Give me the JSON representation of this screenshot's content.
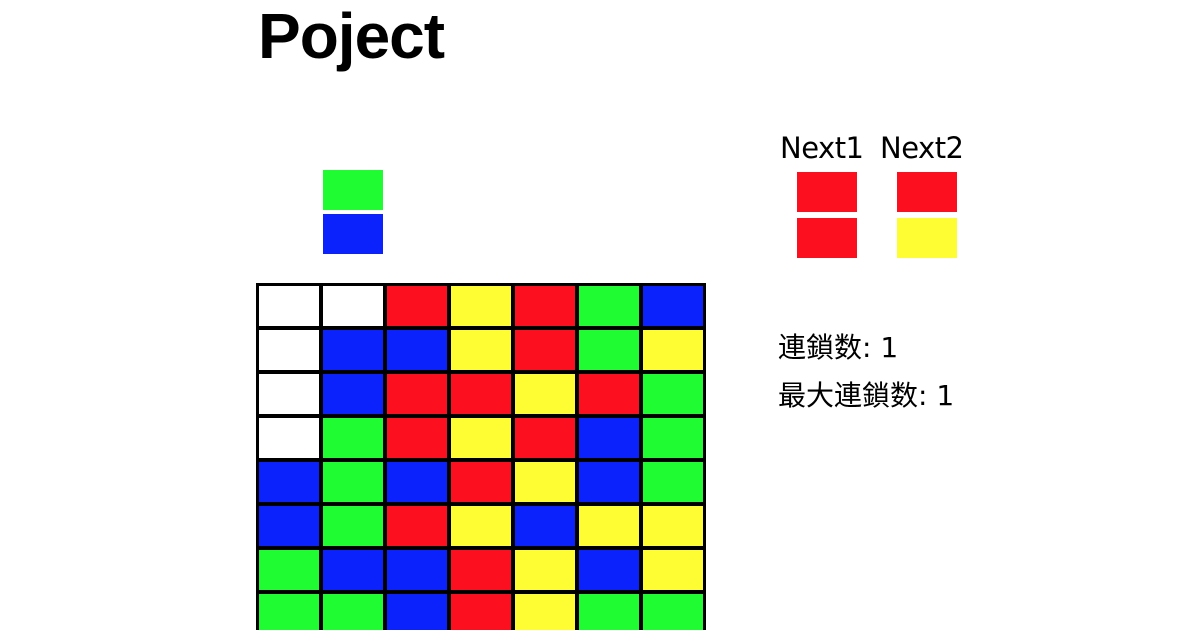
{
  "title": "Poject",
  "colors": {
    "R": "#fc0f1e",
    "Y": "#fefd34",
    "G": "#20fc32",
    "B": "#0c22fc",
    "W": "#ffffff"
  },
  "falling_piece": [
    "G",
    "B"
  ],
  "next": [
    {
      "label": "Next1",
      "pieces": [
        "R",
        "R"
      ]
    },
    {
      "label": "Next2",
      "pieces": [
        "R",
        "Y"
      ]
    }
  ],
  "stats": {
    "chain_label": "連鎖数:",
    "chain_value": "1",
    "max_chain_label": "最大連鎖数:",
    "max_chain_value": "1"
  },
  "board": [
    [
      "W",
      "W",
      "R",
      "Y",
      "R",
      "G",
      "B"
    ],
    [
      "W",
      "B",
      "B",
      "Y",
      "R",
      "G",
      "Y"
    ],
    [
      "W",
      "B",
      "R",
      "R",
      "Y",
      "R",
      "G"
    ],
    [
      "W",
      "G",
      "R",
      "Y",
      "R",
      "B",
      "G"
    ],
    [
      "B",
      "G",
      "B",
      "R",
      "Y",
      "B",
      "G"
    ],
    [
      "B",
      "G",
      "R",
      "Y",
      "B",
      "Y",
      "Y"
    ],
    [
      "G",
      "B",
      "B",
      "R",
      "Y",
      "B",
      "Y"
    ],
    [
      "G",
      "G",
      "B",
      "R",
      "Y",
      "G",
      "G"
    ]
  ]
}
